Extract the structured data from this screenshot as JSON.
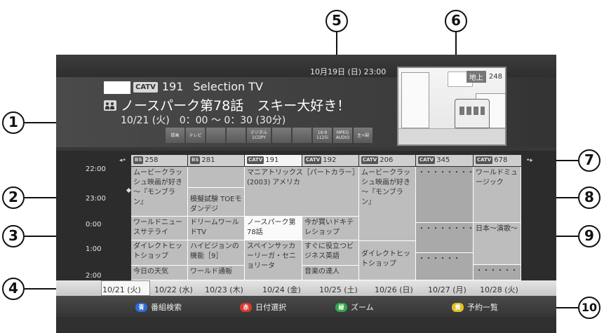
{
  "clock": "10月19日 (日) 23:00",
  "info": {
    "network_tag": "CATV",
    "channel_number": "191",
    "channel_name": "Selection TV",
    "title": "ノースパーク第78話　スキー大好き！",
    "time": "10/21 (火)　0：00 ～ 0：30 (30分)",
    "badges": [
      "録画",
      "テレビ",
      "",
      "",
      "デジタル 1COPY",
      "",
      "",
      "16:9 1125i",
      "MPEG AUDIO",
      "主+副"
    ]
  },
  "preview": {
    "network": "地上",
    "channel": "248"
  },
  "grid": {
    "nav_left": "◂•",
    "nav_right": "•▸",
    "channels": [
      {
        "tag": "BS",
        "num": "258"
      },
      {
        "tag": "BS",
        "num": "281"
      },
      {
        "tag": "CATV",
        "num": "191"
      },
      {
        "tag": "CATV",
        "num": "192"
      },
      {
        "tag": "CATV",
        "num": "206"
      },
      {
        "tag": "CATV",
        "num": "345"
      },
      {
        "tag": "CATV",
        "num": "678"
      }
    ],
    "times": [
      "22:00",
      "23:00",
      "0:00",
      "1:00",
      "2:00"
    ],
    "programs": {
      "c1a": "ムービークラッシュ映画が好き～『モンブラン』",
      "c1b": "ワールドニュースサテライ",
      "c1c": "ダイレクトヒットショップ",
      "c1d": "今日の天気",
      "c2a": "模擬試験 TOEモダンデジ",
      "c2b": "ドリームワールドTV",
      "c2c": "ハイビジョンの機能［9］",
      "c2d": "ワールド通販",
      "c3a": "マニアトリックス［パートカラー］(2003) アメリカ",
      "c3b": "ノースパーク第78話",
      "c3c": "スペインサッカーリーガ・セニョリータ",
      "c4b": "今が買いドキテレショップ",
      "c4c": "すぐに役立つビジネス英語",
      "c4d": "音楽の達人",
      "c5a": "ムービークラッシュ映画が好き～『モンブラン』",
      "c5b": "ダイレクトヒットショップ",
      "c6a": "・・・・・・・・",
      "c6b": "・・・・・・・・・・",
      "c6c": "・・・・・・",
      "c7a": "ワールドミュージック",
      "c7b": "日本～演歌～",
      "c7c": "・・・・・・"
    }
  },
  "dates": [
    "10/21 (火)",
    "10/22 (水)",
    "10/23 (木)",
    "10/24 (金)",
    "10/25 (土)",
    "10/26 (日)",
    "10/27 (月)",
    "10/28 (火)"
  ],
  "hints": [
    {
      "key": "青",
      "label": "番組検索",
      "color": "#2f6bd6"
    },
    {
      "key": "赤",
      "label": "日付選択",
      "color": "#d63a2f"
    },
    {
      "key": "緑",
      "label": "ズーム",
      "color": "#2fa84a"
    },
    {
      "key": "黄",
      "label": "予約一覧",
      "color": "#e0c02a"
    }
  ],
  "callouts": [
    "1",
    "2",
    "3",
    "4",
    "5",
    "6",
    "7",
    "8",
    "9",
    "10"
  ]
}
